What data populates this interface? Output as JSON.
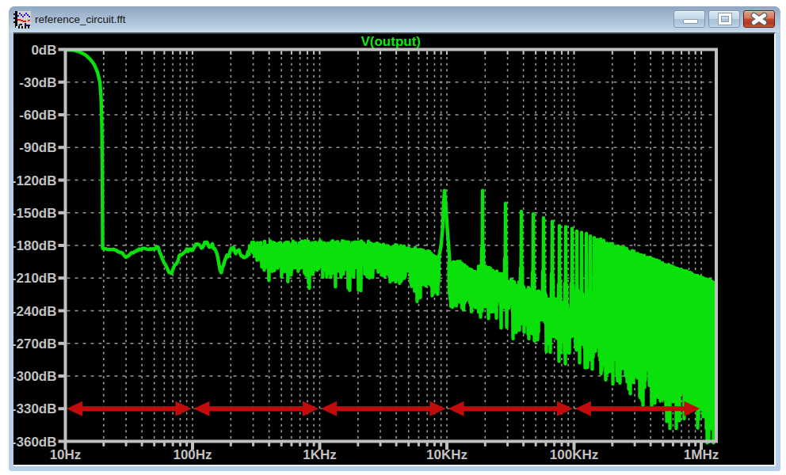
{
  "window": {
    "title": "reference_circuit.fft",
    "buttons": {
      "minimize": "Minimize",
      "maximize": "Maximize",
      "close": "Close"
    }
  },
  "plot": {
    "trace_label": "V(output)",
    "colors": {
      "background": "#000000",
      "frame": "#c0c0c0",
      "grid": "#999999",
      "axis_text": "#c2c2c2",
      "trace": "#0ae00a",
      "trace_title": "#14e414",
      "arrow": "#c20b0b"
    }
  },
  "chart_data": {
    "type": "line",
    "title": "V(output)",
    "x_axis": {
      "scale": "log",
      "unit": "Hz",
      "min_hz": 10,
      "max_hz": 1310000,
      "tick_labels": [
        "10Hz",
        "100Hz",
        "1KHz",
        "10KHz",
        "100KHz",
        "1MHz"
      ],
      "minor_divisions": [
        2,
        3,
        4,
        5,
        6,
        7,
        8,
        9
      ]
    },
    "y_axis": {
      "scale": "linear",
      "unit": "dB",
      "min_db": -360,
      "max_db": 0,
      "step_db": 30,
      "tick_labels": [
        "0dB",
        "-30dB",
        "-60dB",
        "-90dB",
        "-120dB",
        "-150dB",
        "-180dB",
        "-210dB",
        "-240dB",
        "-270dB",
        "-300dB",
        "-330dB",
        "-360dB"
      ]
    },
    "grid": "dashed",
    "legend_position": "top-center",
    "series": [
      {
        "name": "V(output)",
        "color": "#0ae00a",
        "description": "FFT magnitude of V(output): 0dB plateau up to ~20Hz cutoff, noise floor near -183dB, fundamental spur at ~9.6KHz (-129dB) with harmonic comb rolling off to the -230dB/-360dB region at 1MHz",
        "seed": 1337,
        "knee_points_f_db": [
          [
            10.05,
            -0.4
          ],
          [
            11.6,
            -0.6
          ],
          [
            12.85,
            -2
          ],
          [
            14.4,
            -5
          ],
          [
            15.7,
            -9
          ],
          [
            16.9,
            -14
          ],
          [
            17.9,
            -21
          ],
          [
            18.7,
            -30
          ],
          [
            19.1,
            -45
          ],
          [
            19.35,
            -70
          ],
          [
            19.5,
            -110
          ],
          [
            19.64,
            -182
          ]
        ],
        "floor_mean_f_db": [
          [
            19.64,
            -182
          ],
          [
            21,
            -183.5
          ],
          [
            25,
            -184
          ],
          [
            30,
            -190
          ],
          [
            36,
            -184.5
          ],
          [
            43.5,
            -181
          ],
          [
            54,
            -183.5
          ],
          [
            68,
            -205
          ],
          [
            80,
            -187
          ],
          [
            98,
            -185
          ],
          [
            131,
            -177.5
          ],
          [
            149,
            -183
          ],
          [
            168,
            -202
          ],
          [
            185,
            -186
          ],
          [
            220,
            -184
          ],
          [
            282,
            -184.5
          ]
        ],
        "noise_floor_db": -183,
        "band_top_db": -178,
        "fundamental": {
          "freq_hz": 9580,
          "peak_db": -129.5,
          "shape_f_db": [
            [
              8680,
              -190
            ],
            [
              9000,
              -180
            ],
            [
              9270,
              -163
            ],
            [
              9420,
              -144
            ],
            [
              9580,
              -129.5
            ],
            [
              9780,
              -141
            ],
            [
              10050,
              -162
            ],
            [
              10300,
              -180
            ],
            [
              10500,
              -193
            ]
          ]
        },
        "post_peak_mean_f_db": [
          [
            10500,
            -196
          ],
          [
            11300,
            -193.5
          ],
          [
            12600,
            -194.5
          ],
          [
            14100,
            -198
          ],
          [
            16000,
            -202
          ],
          [
            18200,
            -206
          ]
        ],
        "harmonics": {
          "spacing_hz": 9580,
          "first_k": 2,
          "last_k": 137,
          "top_envelope": "max(-133 - 44*(u-3.282), -148 - 58*(u-3.607)) where u = log10(f/10)",
          "inter_spike_floor": "-205 - 55*(u-3.31)"
        }
      }
    ],
    "annotations": {
      "decade_arrows": {
        "db_level": -330,
        "color": "#c20b0b",
        "style": "double-headed",
        "spans": [
          {
            "from": "10Hz",
            "to": "100Hz"
          },
          {
            "from": "100Hz",
            "to": "1KHz"
          },
          {
            "from": "1KHz",
            "to": "10KHz"
          },
          {
            "from": "10KHz",
            "to": "100KHz"
          },
          {
            "from": "100KHz",
            "to": "1MHz"
          }
        ]
      }
    }
  }
}
